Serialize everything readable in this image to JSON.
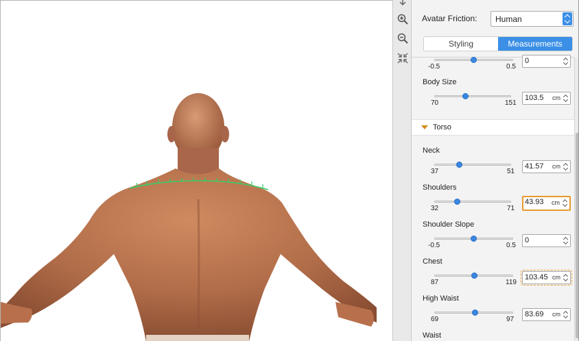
{
  "panel": {
    "friction_label": "Avatar Friction:",
    "friction_value": "Human",
    "tabs": [
      {
        "label": "Styling",
        "active": false
      },
      {
        "label": "Measurements",
        "active": true
      }
    ]
  },
  "controls": {
    "partial_top": {
      "min": "-0.5",
      "max": "0.5",
      "value": "0",
      "position": 0.5
    },
    "body_size": {
      "label": "Body Size",
      "min": "70",
      "max": "151",
      "value": "103.5",
      "unit": "cm",
      "position": 0.41
    },
    "neck": {
      "label": "Neck",
      "min": "37",
      "max": "51",
      "value": "41.57",
      "unit": "cm",
      "position": 0.33
    },
    "shoulders": {
      "label": "Shoulders",
      "min": "32",
      "max": "71",
      "value": "43.93",
      "unit": "cm",
      "position": 0.3
    },
    "shoulder_slope": {
      "label": "Shoulder Slope",
      "min": "-0.5",
      "max": "0.5",
      "value": "0",
      "position": 0.5
    },
    "chest": {
      "label": "Chest",
      "min": "87",
      "max": "119",
      "value": "103.45",
      "unit": "cm",
      "position": 0.51
    },
    "high_waist": {
      "label": "High Waist",
      "min": "69",
      "max": "97",
      "value": "83.69",
      "unit": "cm",
      "position": 0.52
    },
    "waist": {
      "label": "Waist"
    }
  },
  "section": {
    "torso_label": "Torso"
  },
  "icons": {
    "tool_1": "move-down-icon",
    "tool_2": "zoom-in-icon",
    "tool_3": "zoom-out-icon",
    "tool_4": "collapse-icon"
  },
  "colors": {
    "accent": "#3b8fe6",
    "focus": "#e79a2c",
    "skin": "#b8704c",
    "measure_line": "#34d06a"
  }
}
